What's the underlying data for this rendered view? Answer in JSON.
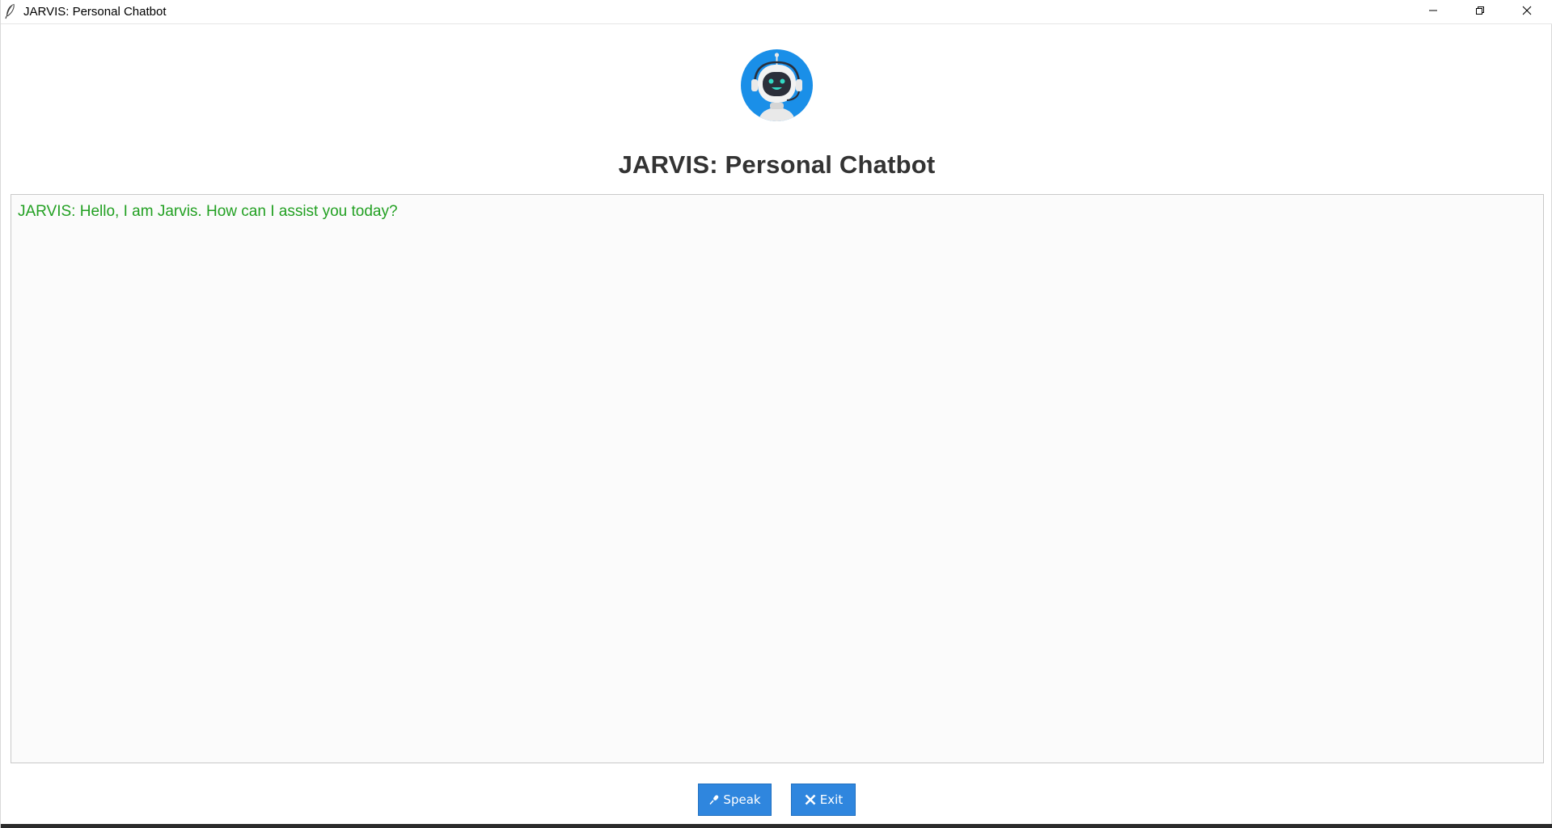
{
  "window": {
    "title": "JARVIS: Personal Chatbot",
    "controls": {
      "minimize_icon": "minimize-icon",
      "maximize_icon": "restore-icon",
      "close_icon": "close-icon"
    }
  },
  "header": {
    "logo_icon": "robot-headset-icon",
    "title": "JARVIS: Personal Chatbot"
  },
  "chat": {
    "messages": [
      {
        "text": "JARVIS: Hello, I am Jarvis. How can I assist you today?",
        "color": "#22a022"
      }
    ]
  },
  "buttons": {
    "speak": {
      "label": "Speak",
      "icon": "microphone-icon"
    },
    "exit": {
      "label": "Exit",
      "icon": "close-x-icon"
    }
  },
  "colors": {
    "accent": "#2f86de",
    "message_green": "#22a022",
    "logo_blue": "#1a8fe8",
    "heading": "#333333"
  }
}
